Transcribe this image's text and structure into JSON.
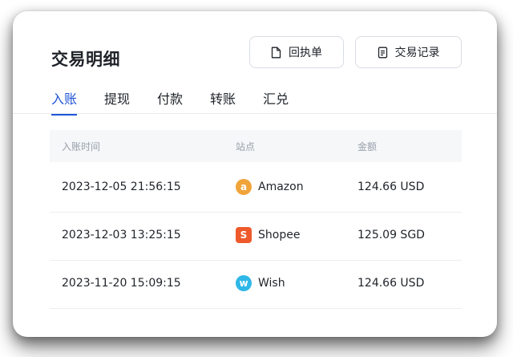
{
  "header": {
    "title": "交易明细"
  },
  "actions": {
    "receipt_label": "回执单",
    "records_label": "交易记录"
  },
  "tabs": [
    {
      "label": "入账",
      "active": true
    },
    {
      "label": "提现",
      "active": false
    },
    {
      "label": "付款",
      "active": false
    },
    {
      "label": "转账",
      "active": false
    },
    {
      "label": "汇兑",
      "active": false
    }
  ],
  "table": {
    "columns": [
      "入账时间",
      "站点",
      "金额"
    ],
    "rows": [
      {
        "time": "2023-12-05 21:56:15",
        "site": "Amazon",
        "site_icon": "amazon-icon",
        "site_color": "#f0a43a",
        "glyph": "a",
        "amount": "124.66 USD"
      },
      {
        "time": "2023-12-03 13:25:15",
        "site": "Shopee",
        "site_icon": "shopee-icon",
        "site_color": "#ee5a2b",
        "glyph": "S",
        "amount": "125.09 SGD"
      },
      {
        "time": "2023-11-20 15:09:15",
        "site": "Wish",
        "site_icon": "wish-icon",
        "site_color": "#2fb7e8",
        "glyph": "w",
        "amount": "124.66 USD"
      }
    ]
  },
  "colors": {
    "accent": "#1e54d6",
    "text": "#1f2329",
    "muted": "#98a0aa"
  }
}
